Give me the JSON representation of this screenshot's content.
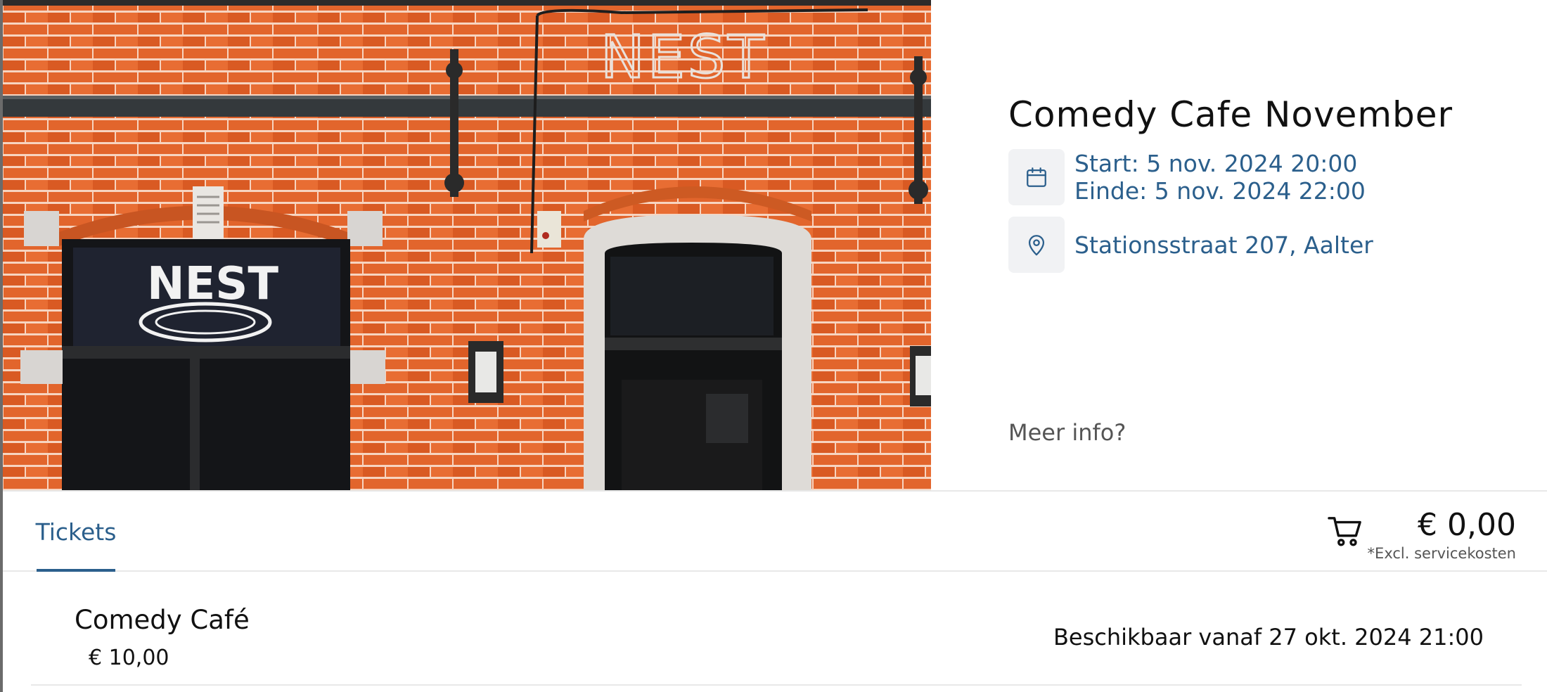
{
  "event": {
    "title": "Comedy Cafe November",
    "start": "Start: 5 nov. 2024 20:00",
    "end": "Einde: 5 nov. 2024 22:00",
    "location": "Stationsstraat 207, Aalter",
    "more_info": "Meer info?",
    "image": {
      "sign_text": "NEST",
      "window_logo_text": "NEST"
    }
  },
  "tabs": [
    {
      "label": "Tickets",
      "active": true
    }
  ],
  "cart": {
    "icon": "cart-icon",
    "total": "€ 0,00",
    "note": "*Excl. servicekosten"
  },
  "tickets": [
    {
      "name": "Comedy Café",
      "price": "€ 10,00",
      "availability": "Beschikbaar vanaf 27 okt. 2024 21:00"
    }
  ],
  "icons": {
    "date": "calendar-icon",
    "location": "map-pin-icon"
  },
  "colors": {
    "accent": "#2b5f8c",
    "icon_bg": "#f1f2f4",
    "brick": "#e0642a",
    "mortar": "#f6d6c4"
  }
}
